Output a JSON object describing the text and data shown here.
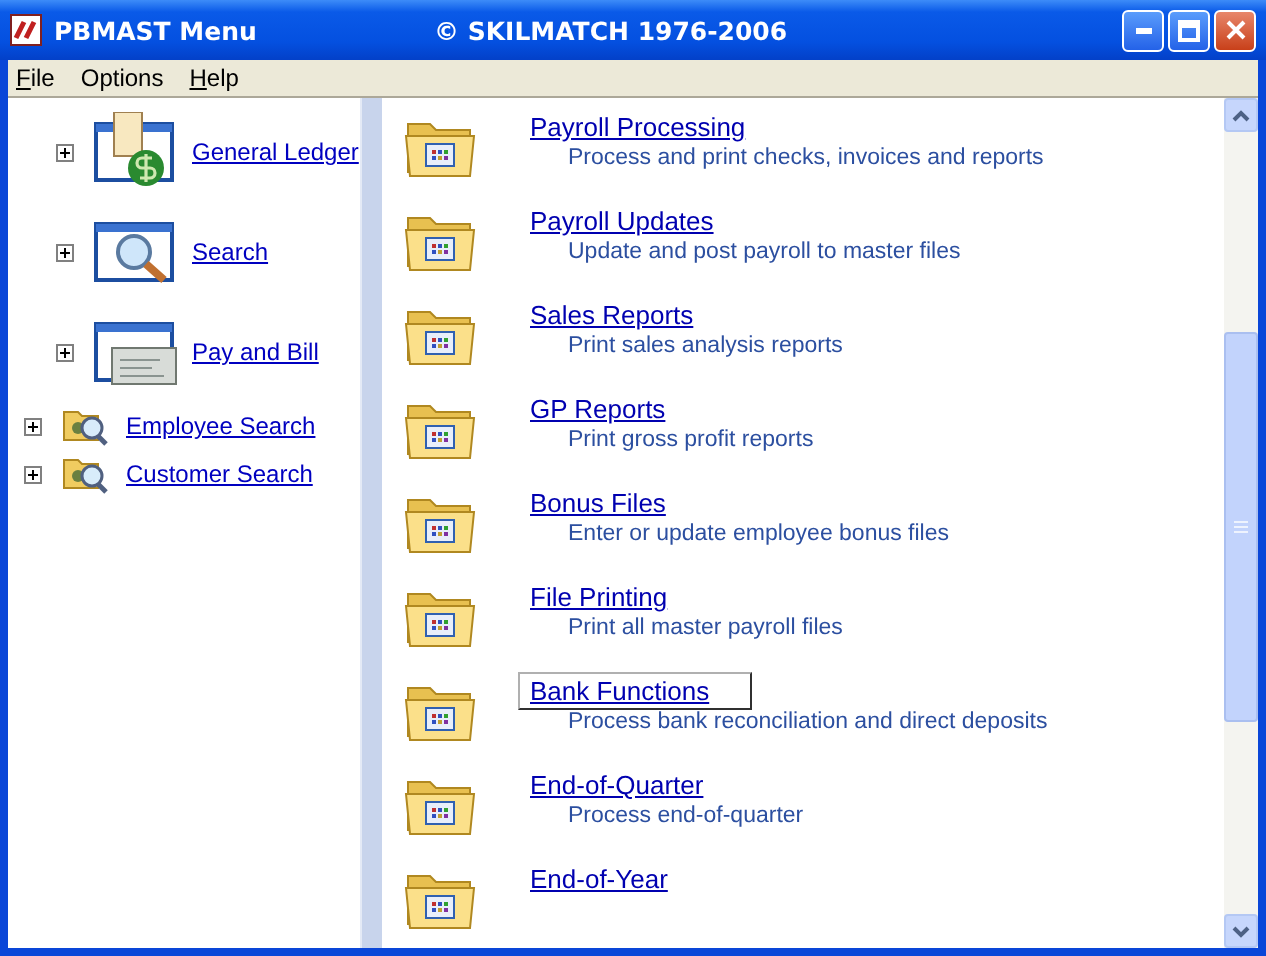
{
  "window": {
    "title": "PBMAST Menu",
    "caption": "© SKILMATCH 1976-2006"
  },
  "menu": [
    {
      "label": "File",
      "underlined": true
    },
    {
      "label": "Options",
      "underlined": false
    },
    {
      "label": "Help",
      "underlined": true
    }
  ],
  "sidebar": {
    "items": [
      {
        "kind": "ledger",
        "label": "General Ledger",
        "expanded": false
      },
      {
        "kind": "search",
        "label": "Search",
        "expanded": false
      },
      {
        "kind": "check",
        "label": "Pay and Bill",
        "expanded": false
      },
      {
        "kind": "finder",
        "label": "Employee Search",
        "expanded": false
      },
      {
        "kind": "finder",
        "label": "Customer Search",
        "expanded": false
      }
    ]
  },
  "modules": [
    {
      "title": "Payroll Processing",
      "description": "Process and print checks, invoices and reports",
      "selected": false
    },
    {
      "title": "Payroll Updates",
      "description": "Update and post payroll to master files",
      "selected": false
    },
    {
      "title": "Sales Reports",
      "description": "Print sales analysis reports",
      "selected": false
    },
    {
      "title": "GP Reports",
      "description": "Print gross profit reports",
      "selected": false
    },
    {
      "title": "Bonus Files",
      "description": "Enter or update employee bonus files",
      "selected": false
    },
    {
      "title": "File Printing",
      "description": "Print all master payroll files",
      "selected": false
    },
    {
      "title": "Bank Functions",
      "description": "Process bank reconciliation and direct deposits",
      "selected": true
    },
    {
      "title": "End-of-Quarter",
      "description": "Process end-of-quarter",
      "selected": false
    },
    {
      "title": "End-of-Year",
      "selected": false
    }
  ]
}
